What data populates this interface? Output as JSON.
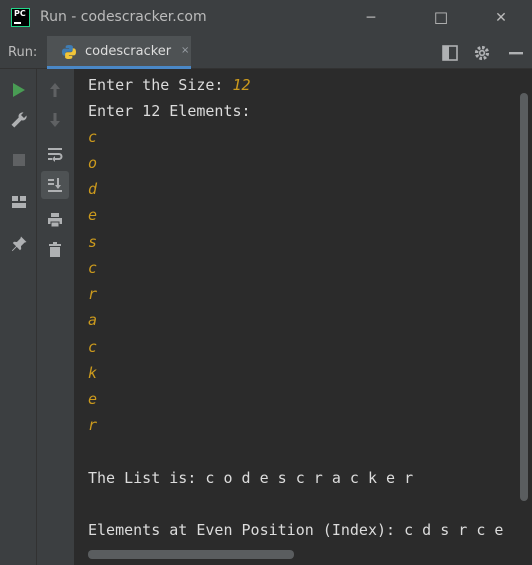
{
  "window": {
    "title": "Run - codescracker.com",
    "logo_text": "PC",
    "minimize_glyph": "─",
    "maximize_glyph": "☐",
    "close_glyph": "✕"
  },
  "run_panel": {
    "label": "Run:",
    "tab_label": "codescracker",
    "tab_close_glyph": "×"
  },
  "console": {
    "size_prompt": "Enter the Size: ",
    "size_value": "12",
    "elements_prompt": "Enter 12 Elements:",
    "inputs": [
      "c",
      "o",
      "d",
      "e",
      "s",
      "c",
      "r",
      "a",
      "c",
      "k",
      "e",
      "r"
    ],
    "list_line": "The List is: c o d e s c r a c k e r",
    "even_line": "Elements at Even Position (Index): c d s r c e"
  },
  "colors": {
    "accent": "#4a88c7",
    "run_green": "#499c54",
    "input_color": "#cc9a1d"
  },
  "icons": {
    "run": "run-icon",
    "wrench": "wrench-icon",
    "stop": "stop-icon",
    "layout": "layout-icon",
    "pin": "pin-icon",
    "up": "arrow-up-icon",
    "down": "arrow-down-icon",
    "wrap": "soft-wrap-icon",
    "scroll_end": "scroll-to-end-icon",
    "print": "print-icon",
    "trash": "trash-icon",
    "gear": "gear-icon",
    "restore": "restore-layout-icon",
    "hide": "hide-icon"
  }
}
